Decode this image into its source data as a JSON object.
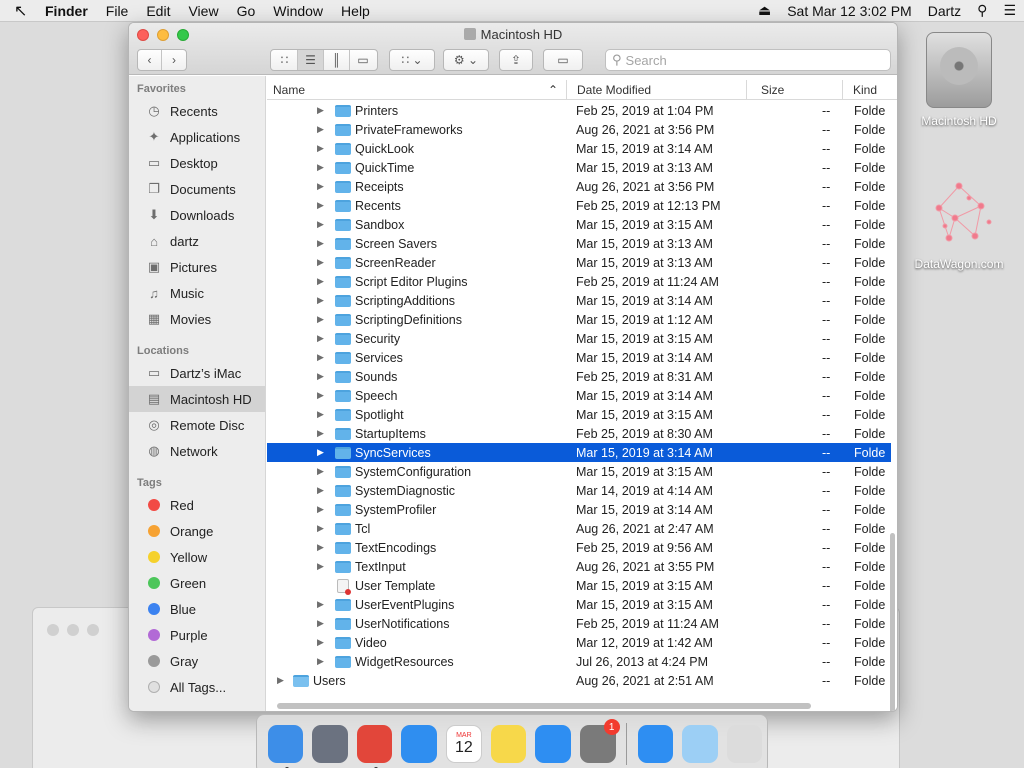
{
  "menubar": {
    "app_name": "Finder",
    "items": [
      "File",
      "Edit",
      "View",
      "Go",
      "Window",
      "Help"
    ],
    "date_time": "Sat Mar 12  3:02 PM",
    "user": "Dartz"
  },
  "desktop": {
    "icons": [
      {
        "label": "Macintosh HD",
        "icon": "hard-drive-icon"
      },
      {
        "label": "DataWagon.com",
        "icon": "network-graph-icon"
      }
    ]
  },
  "finder": {
    "title": "Macintosh HD",
    "search_placeholder": "Search",
    "columns": {
      "name": "Name",
      "date": "Date Modified",
      "size": "Size",
      "kind": "Kind"
    },
    "sidebar": {
      "favorites_header": "Favorites",
      "favorites": [
        {
          "label": "Recents",
          "icon": "clock-icon"
        },
        {
          "label": "Applications",
          "icon": "applications-icon"
        },
        {
          "label": "Desktop",
          "icon": "desktop-icon"
        },
        {
          "label": "Documents",
          "icon": "documents-icon"
        },
        {
          "label": "Downloads",
          "icon": "downloads-icon"
        },
        {
          "label": "dartz",
          "icon": "home-icon"
        },
        {
          "label": "Pictures",
          "icon": "pictures-icon"
        },
        {
          "label": "Music",
          "icon": "music-icon"
        },
        {
          "label": "Movies",
          "icon": "movies-icon"
        }
      ],
      "locations_header": "Locations",
      "locations": [
        {
          "label": "Dartz’s iMac",
          "icon": "imac-icon"
        },
        {
          "label": "Macintosh HD",
          "icon": "hard-drive-icon"
        },
        {
          "label": "Remote Disc",
          "icon": "disc-icon"
        },
        {
          "label": "Network",
          "icon": "globe-icon"
        }
      ],
      "tags_header": "Tags",
      "tags": [
        {
          "label": "Red",
          "color": "#f24a44"
        },
        {
          "label": "Orange",
          "color": "#f6a233"
        },
        {
          "label": "Yellow",
          "color": "#f5d12c"
        },
        {
          "label": "Green",
          "color": "#4cc65a"
        },
        {
          "label": "Blue",
          "color": "#3b82f0"
        },
        {
          "label": "Purple",
          "color": "#b26ad6"
        },
        {
          "label": "Gray",
          "color": "#9a9a9a"
        },
        {
          "label": "All Tags...",
          "color": "#e0e0e0"
        }
      ]
    },
    "rows": [
      {
        "name": "Printers",
        "date": "Feb 25, 2019 at 1:04 PM",
        "size": "--",
        "kind": "Folde"
      },
      {
        "name": "PrivateFrameworks",
        "date": "Aug 26, 2021 at 3:56 PM",
        "size": "--",
        "kind": "Folde"
      },
      {
        "name": "QuickLook",
        "date": "Mar 15, 2019 at 3:14 AM",
        "size": "--",
        "kind": "Folde"
      },
      {
        "name": "QuickTime",
        "date": "Mar 15, 2019 at 3:13 AM",
        "size": "--",
        "kind": "Folde"
      },
      {
        "name": "Receipts",
        "date": "Aug 26, 2021 at 3:56 PM",
        "size": "--",
        "kind": "Folde"
      },
      {
        "name": "Recents",
        "date": "Feb 25, 2019 at 12:13 PM",
        "size": "--",
        "kind": "Folde"
      },
      {
        "name": "Sandbox",
        "date": "Mar 15, 2019 at 3:15 AM",
        "size": "--",
        "kind": "Folde"
      },
      {
        "name": "Screen Savers",
        "date": "Mar 15, 2019 at 3:13 AM",
        "size": "--",
        "kind": "Folde"
      },
      {
        "name": "ScreenReader",
        "date": "Mar 15, 2019 at 3:13 AM",
        "size": "--",
        "kind": "Folde"
      },
      {
        "name": "Script Editor Plugins",
        "date": "Feb 25, 2019 at 11:24 AM",
        "size": "--",
        "kind": "Folde"
      },
      {
        "name": "ScriptingAdditions",
        "date": "Mar 15, 2019 at 3:14 AM",
        "size": "--",
        "kind": "Folde"
      },
      {
        "name": "ScriptingDefinitions",
        "date": "Mar 15, 2019 at 1:12 AM",
        "size": "--",
        "kind": "Folde"
      },
      {
        "name": "Security",
        "date": "Mar 15, 2019 at 3:15 AM",
        "size": "--",
        "kind": "Folde"
      },
      {
        "name": "Services",
        "date": "Mar 15, 2019 at 3:14 AM",
        "size": "--",
        "kind": "Folde"
      },
      {
        "name": "Sounds",
        "date": "Feb 25, 2019 at 8:31 AM",
        "size": "--",
        "kind": "Folde"
      },
      {
        "name": "Speech",
        "date": "Mar 15, 2019 at 3:14 AM",
        "size": "--",
        "kind": "Folde"
      },
      {
        "name": "Spotlight",
        "date": "Mar 15, 2019 at 3:15 AM",
        "size": "--",
        "kind": "Folde"
      },
      {
        "name": "StartupItems",
        "date": "Feb 25, 2019 at 8:30 AM",
        "size": "--",
        "kind": "Folde"
      },
      {
        "name": "SyncServices",
        "date": "Mar 15, 2019 at 3:14 AM",
        "size": "--",
        "kind": "Folde",
        "selected": true
      },
      {
        "name": "SystemConfiguration",
        "date": "Mar 15, 2019 at 3:15 AM",
        "size": "--",
        "kind": "Folde"
      },
      {
        "name": "SystemDiagnostic",
        "date": "Mar 14, 2019 at 4:14 AM",
        "size": "--",
        "kind": "Folde"
      },
      {
        "name": "SystemProfiler",
        "date": "Mar 15, 2019 at 3:14 AM",
        "size": "--",
        "kind": "Folde"
      },
      {
        "name": "Tcl",
        "date": "Aug 26, 2021 at 2:47 AM",
        "size": "--",
        "kind": "Folde"
      },
      {
        "name": "TextEncodings",
        "date": "Feb 25, 2019 at 9:56 AM",
        "size": "--",
        "kind": "Folde"
      },
      {
        "name": "TextInput",
        "date": "Aug 26, 2021 at 3:55 PM",
        "size": "--",
        "kind": "Folde"
      },
      {
        "name": "User Template",
        "date": "Mar 15, 2019 at 3:15 AM",
        "size": "--",
        "kind": "Folde",
        "restricted": true
      },
      {
        "name": "UserEventPlugins",
        "date": "Mar 15, 2019 at 3:15 AM",
        "size": "--",
        "kind": "Folde"
      },
      {
        "name": "UserNotifications",
        "date": "Feb 25, 2019 at 11:24 AM",
        "size": "--",
        "kind": "Folde"
      },
      {
        "name": "Video",
        "date": "Mar 12, 2019 at 1:42 AM",
        "size": "--",
        "kind": "Folde"
      },
      {
        "name": "WidgetResources",
        "date": "Jul 26, 2013 at 4:24 PM",
        "size": "--",
        "kind": "Folde"
      },
      {
        "name": "Users",
        "date": "Aug 26, 2021 at 2:51 AM",
        "size": "--",
        "kind": "Folde",
        "top_level": true
      }
    ]
  },
  "dock": {
    "apps": [
      {
        "name": "Finder",
        "icon": "finder-icon",
        "color": "#3d8ee8",
        "running": true
      },
      {
        "name": "Launchpad",
        "icon": "launchpad-icon",
        "color": "#6b7280"
      },
      {
        "name": "Chrome",
        "icon": "chrome-icon",
        "color": "#e2463a",
        "running": true
      },
      {
        "name": "Safari",
        "icon": "safari-icon",
        "color": "#2f8ef0"
      },
      {
        "name": "Calendar",
        "icon": "calendar-icon",
        "color": "#ffffff",
        "text": "12",
        "month": "MAR"
      },
      {
        "name": "Notes",
        "icon": "notes-icon",
        "color": "#f7d84a"
      },
      {
        "name": "App Store",
        "icon": "app-store-icon",
        "color": "#2e8ef2"
      },
      {
        "name": "System Preferences",
        "icon": "gear-icon",
        "color": "#7a7a7a",
        "badge": "1"
      }
    ],
    "others": [
      {
        "name": "App Store Folder",
        "icon": "app-store-icon",
        "color": "#2e8ef2"
      },
      {
        "name": "Downloads",
        "icon": "downloads-folder-icon",
        "color": "#9ccff5"
      },
      {
        "name": "Trash",
        "icon": "trash-icon",
        "color": "#dcdcdc"
      }
    ]
  }
}
